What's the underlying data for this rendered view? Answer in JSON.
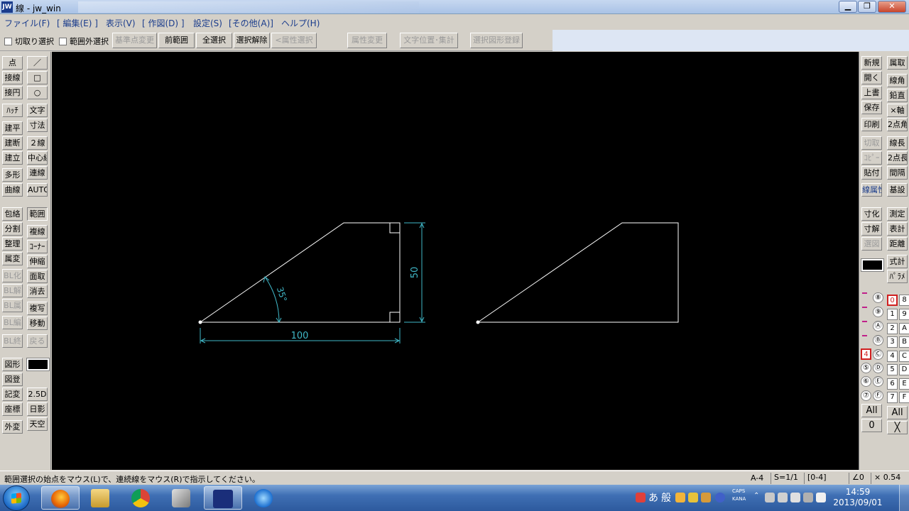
{
  "window": {
    "app_icon": "JW",
    "title": "線 - jw_win",
    "min_label": "▁",
    "max_label": "❐",
    "close_label": "✕"
  },
  "menu": [
    "ファイル(F)",
    "[ 編集(E) ]",
    "表示(V)",
    "[ 作図(D) ]",
    "設定(S)",
    "[その他(A)]",
    "ヘルプ(H)"
  ],
  "toolbar": {
    "chk_cut": "切取り選択",
    "chk_outside": "範囲外選択",
    "btn_base": "基準点変更",
    "btn_prev": "前範囲",
    "btn_all": "全選択",
    "btn_release": "選択解除",
    "btn_attr_sel": "<属性選択>",
    "btn_attr_change": "属性変更",
    "btn_text_pos": "文字位置･集計",
    "btn_register": "選択図形登録"
  },
  "left_tools": {
    "col1": [
      "点",
      "接線",
      "接円",
      "ﾊｯﾁ",
      "建平",
      "建断",
      "建立",
      "多形",
      "曲線",
      "包絡",
      "分割",
      "整理",
      "属変",
      "BL化",
      "BL解",
      "BL属",
      "BL編",
      "BL終",
      "図形",
      "図登",
      "記変",
      "座標",
      "外変"
    ],
    "col2": [
      "／",
      "□",
      "○",
      "文字",
      "寸法",
      "２線",
      "中心線",
      "連線",
      "AUTO",
      "範囲",
      "複線",
      "ｺｰﾅｰ",
      "伸縮",
      "面取",
      "消去",
      "複写",
      "移動",
      "戻る",
      "2.5D",
      "日影",
      "天空"
    ]
  },
  "right_tools": {
    "col1": [
      "新規",
      "開く",
      "上書",
      "保存",
      "印刷",
      "切取",
      "ｺﾋﾟｰ",
      "貼付",
      "線属性",
      "寸化",
      "寸解",
      "選図"
    ],
    "col2": [
      "属取",
      "線角",
      "鉛直",
      "×軸",
      "2点角",
      "線長",
      "2点長",
      "間隔",
      "基設",
      "測定",
      "表計",
      "距離",
      "式計",
      "ﾊﾟﾗﾒ"
    ]
  },
  "layers": {
    "circles": [
      "⑧",
      "⑨",
      "Ⓐ",
      "Ⓑ",
      "Ⓒ",
      "⑤",
      "⑥",
      "⑦"
    ],
    "circles2": [
      "Ⓓ",
      "Ⓔ",
      "Ⓕ"
    ],
    "layer4": "4",
    "groups_a": [
      "0",
      "1",
      "2",
      "3",
      "4",
      "5",
      "6",
      "7"
    ],
    "groups_b": [
      "8",
      "9",
      "A",
      "B",
      "C",
      "D",
      "E",
      "F"
    ],
    "all_label": "All",
    "zero_label": "0",
    "all_label2": "All",
    "x_label": "╳"
  },
  "drawing": {
    "dim_width": "100",
    "dim_height": "50",
    "dim_angle": "35°"
  },
  "status": {
    "message": "範囲選択の始点をマウス(L)で、連続線をマウス(R)で指示してください。",
    "paper": "A-4",
    "scale": "S=1/1",
    "layer": "[0-4]",
    "angle": "∠0",
    "factor": "× 0.54"
  },
  "taskbar": {
    "ime_a": "あ",
    "ime_han": "般",
    "caps": "CAPS",
    "kana": "KANA",
    "time": "14:59",
    "date": "2013/09/01"
  }
}
